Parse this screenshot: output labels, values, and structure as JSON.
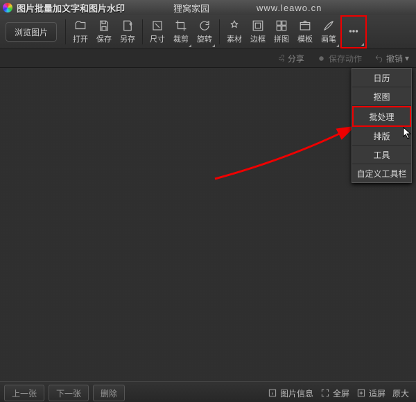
{
  "title": "图片批量加文字和图片水印",
  "site_name": "狸窝家园",
  "site_url": "www.leawo.cn",
  "browse_button": "浏览图片",
  "toolbar": [
    {
      "id": "open",
      "label": "打开"
    },
    {
      "id": "save",
      "label": "保存"
    },
    {
      "id": "saveas",
      "label": "另存"
    },
    {
      "id": "size",
      "label": "尺寸"
    },
    {
      "id": "crop",
      "label": "裁剪"
    },
    {
      "id": "rotate",
      "label": "旋转"
    },
    {
      "id": "material",
      "label": "素材"
    },
    {
      "id": "frame",
      "label": "边框"
    },
    {
      "id": "collage",
      "label": "拼图"
    },
    {
      "id": "template",
      "label": "模板"
    },
    {
      "id": "brush",
      "label": "画笔"
    },
    {
      "id": "more",
      "label": ""
    }
  ],
  "secbar": {
    "share": "分享",
    "save_action": "保存动作",
    "undo": "撤销"
  },
  "dropdown": [
    {
      "id": "calendar",
      "label": "日历"
    },
    {
      "id": "cutout",
      "label": "抠图"
    },
    {
      "id": "batch",
      "label": "批处理",
      "hl": true
    },
    {
      "id": "layout",
      "label": "排版"
    },
    {
      "id": "tools",
      "label": "工具"
    },
    {
      "id": "custom",
      "label": "自定义工具栏"
    }
  ],
  "bottom": {
    "prev": "上一张",
    "next": "下一张",
    "delete": "删除",
    "info": "图片信息",
    "fullscreen": "全屏",
    "fit": "适屏",
    "orig": "原大"
  }
}
